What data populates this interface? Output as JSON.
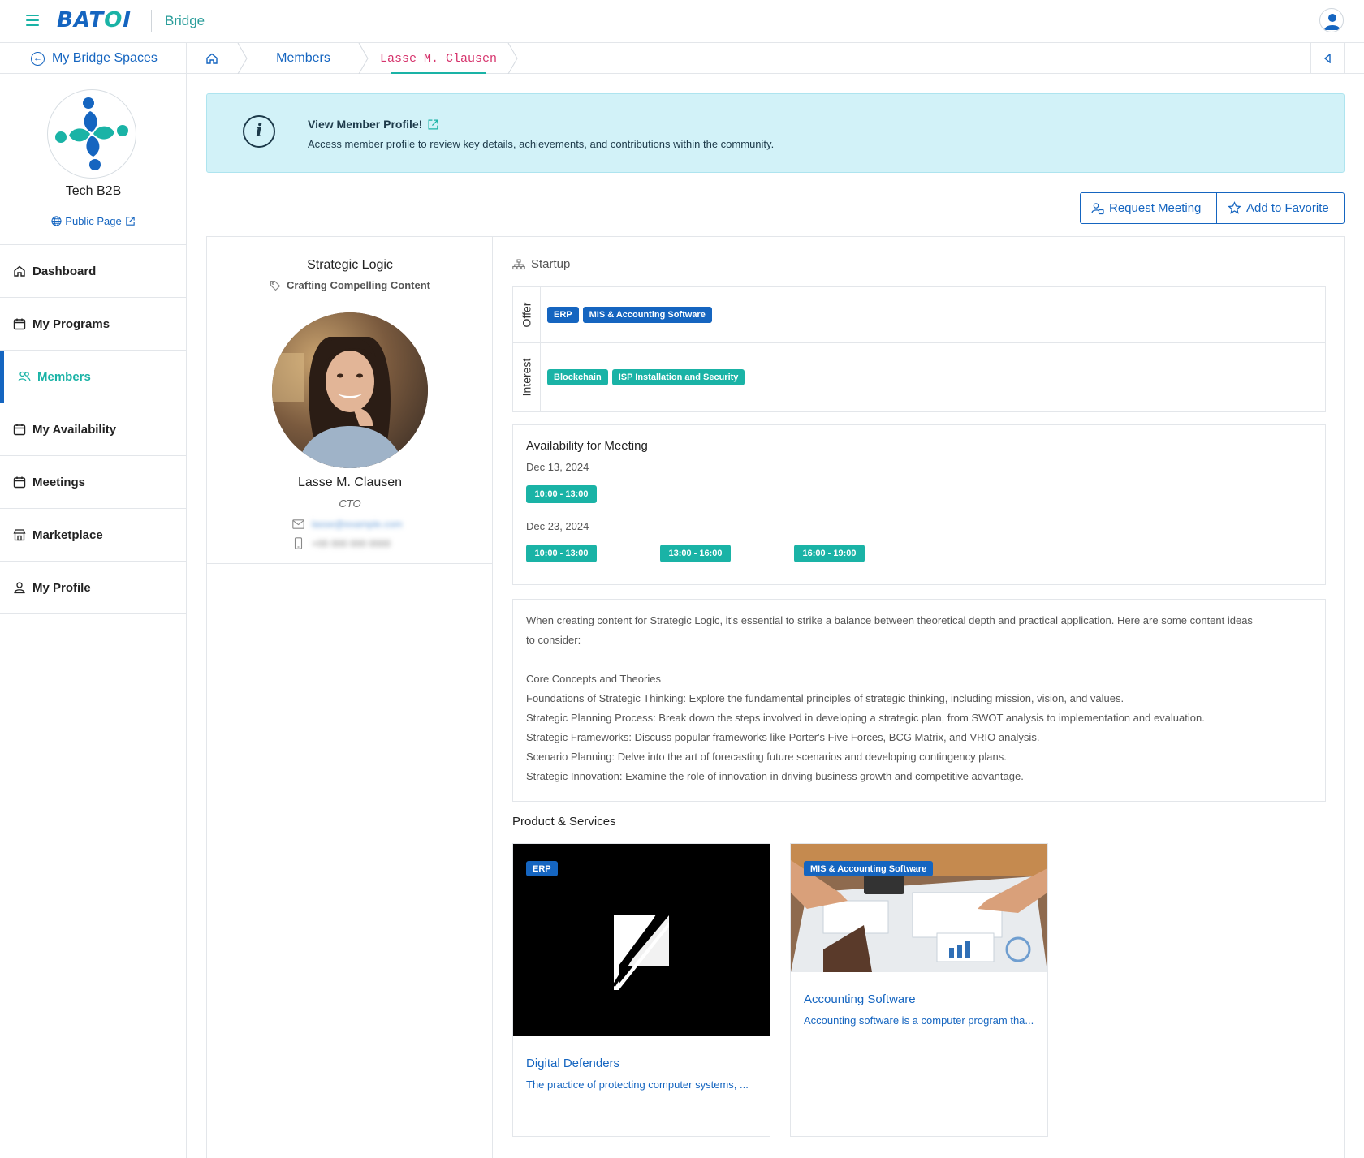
{
  "topbar": {
    "brand": "BATOI",
    "product": "Bridge"
  },
  "crumbbar": {
    "spaces_label": "My Bridge Spaces",
    "crumbs": [
      "Members",
      "Lasse M. Clausen"
    ]
  },
  "sidebar": {
    "org_name": "Tech B2B",
    "public_page_label": "Public Page",
    "items": [
      {
        "label": "Dashboard",
        "icon": "home-icon"
      },
      {
        "label": "My Programs",
        "icon": "calendar-icon"
      },
      {
        "label": "Members",
        "icon": "users-icon",
        "active": true
      },
      {
        "label": "My Availability",
        "icon": "calendar-icon"
      },
      {
        "label": "Meetings",
        "icon": "calendar-icon"
      },
      {
        "label": "Marketplace",
        "icon": "store-icon"
      },
      {
        "label": "My Profile",
        "icon": "user-icon"
      }
    ]
  },
  "banner": {
    "title": "View Member Profile!",
    "text": "Access member profile to review key details, achievements, and contributions within the community."
  },
  "actions": {
    "request_meeting": "Request Meeting",
    "add_favorite": "Add to Favorite"
  },
  "profile": {
    "company": "Strategic Logic",
    "tagline": "Crafting Compelling Content",
    "name": "Lasse M. Clausen",
    "title": "CTO",
    "email": "lasse@example.com",
    "phone": "+00 000 000 0000"
  },
  "startup": {
    "label": "Startup",
    "offer_label": "Offer",
    "offer_tags": [
      "ERP",
      "MIS & Accounting Software"
    ],
    "interest_label": "Interest",
    "interest_tags": [
      "Blockchain",
      "ISP Installation and Security"
    ]
  },
  "availability": {
    "title": "Availability for Meeting",
    "dates": [
      {
        "date": "Dec 13, 2024",
        "slots": [
          "10:00 - 13:00"
        ]
      },
      {
        "date": "Dec 23, 2024",
        "slots": [
          "10:00 - 13:00",
          "13:00 - 16:00",
          "16:00 - 19:00"
        ]
      }
    ]
  },
  "description": {
    "lines": [
      "When creating content for Strategic Logic, it's essential to strike a balance between theoretical depth and practical application. Here are some content ideas",
      "to consider:",
      "",
      "Core Concepts and Theories",
      "Foundations of Strategic Thinking: Explore the fundamental principles of strategic thinking, including mission, vision, and values.",
      "Strategic Planning Process: Break down the steps involved in developing a strategic plan, from SWOT analysis to implementation and evaluation.",
      "Strategic Frameworks: Discuss popular frameworks like Porter's Five Forces, BCG Matrix, and VRIO analysis.",
      "Scenario Planning: Delve into the art of forecasting future scenarios and developing contingency plans.",
      "Strategic Innovation: Examine the role of innovation in driving business growth and competitive advantage."
    ]
  },
  "products": {
    "title": "Product & Services",
    "items": [
      {
        "tag": "ERP",
        "name": "Digital Defenders",
        "desc": "The practice of protecting computer systems, ..."
      },
      {
        "tag": "MIS & Accounting Software",
        "name": "Accounting Software",
        "desc": "Accounting software is a computer program tha..."
      }
    ]
  },
  "colors": {
    "brand_blue": "#1565c0",
    "brand_teal": "#1ab3a6",
    "banner_bg": "#d2f2f8",
    "breadcrumb_active": "#d6336c"
  }
}
